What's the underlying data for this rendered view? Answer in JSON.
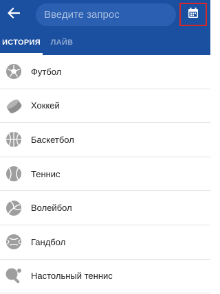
{
  "header": {
    "search_placeholder": "Введите запрос",
    "back_icon": "arrow-left-icon",
    "calendar_icon": "calendar-icon",
    "background_color": "#1b4fa0",
    "highlight_color": "#d62828"
  },
  "tabs": [
    {
      "label": "ИСТОРИЯ",
      "active": true
    },
    {
      "label": "ЛАЙВ",
      "active": false
    }
  ],
  "sports": [
    {
      "label": "Футбол",
      "icon": "football-icon"
    },
    {
      "label": "Хоккей",
      "icon": "hockey-puck-icon"
    },
    {
      "label": "Баскетбол",
      "icon": "basketball-icon"
    },
    {
      "label": "Теннис",
      "icon": "tennis-ball-icon"
    },
    {
      "label": "Волейбол",
      "icon": "volleyball-icon"
    },
    {
      "label": "Гандбол",
      "icon": "handball-icon"
    },
    {
      "label": "Настольный теннис",
      "icon": "table-tennis-icon"
    }
  ]
}
